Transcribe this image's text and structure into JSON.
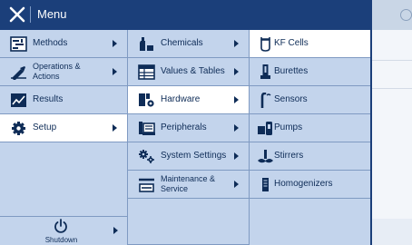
{
  "menu": {
    "title": "Menu"
  },
  "col1": [
    {
      "label": "Methods",
      "icon": "methods-icon",
      "arrow": true
    },
    {
      "label": "Operations & Actions",
      "icon": "operations-icon",
      "arrow": true,
      "twoline": true
    },
    {
      "label": "Results",
      "icon": "results-icon",
      "arrow": false
    },
    {
      "label": "Setup",
      "icon": "gear-icon",
      "arrow": true,
      "selected": true
    }
  ],
  "shutdown": {
    "label": "Shutdown",
    "icon": "power-icon"
  },
  "col2": [
    {
      "label": "Chemicals",
      "icon": "chemicals-icon",
      "arrow": true
    },
    {
      "label": "Values & Tables",
      "icon": "table-icon",
      "arrow": true
    },
    {
      "label": "Hardware",
      "icon": "hardware-icon",
      "arrow": true,
      "selected": true
    },
    {
      "label": "Peripherals",
      "icon": "peripherals-icon",
      "arrow": true
    },
    {
      "label": "System Settings",
      "icon": "system-settings-icon",
      "arrow": true
    },
    {
      "label": "Maintenance & Service",
      "icon": "maintenance-icon",
      "arrow": true,
      "twoline": true
    }
  ],
  "col3": [
    {
      "label": "KF Cells",
      "icon": "kf-cell-icon",
      "selected": true
    },
    {
      "label": "Burettes",
      "icon": "burette-icon"
    },
    {
      "label": "Sensors",
      "icon": "sensor-icon"
    },
    {
      "label": "Pumps",
      "icon": "pump-icon"
    },
    {
      "label": "Stirrers",
      "icon": "stirrer-icon"
    },
    {
      "label": "Homogenizers",
      "icon": "homogenizer-icon"
    }
  ],
  "colors": {
    "titlebar": "#1b3f7a",
    "menu_bg": "#c3d4ec",
    "selected_bg": "#ffffff",
    "text": "#0e2c57"
  }
}
